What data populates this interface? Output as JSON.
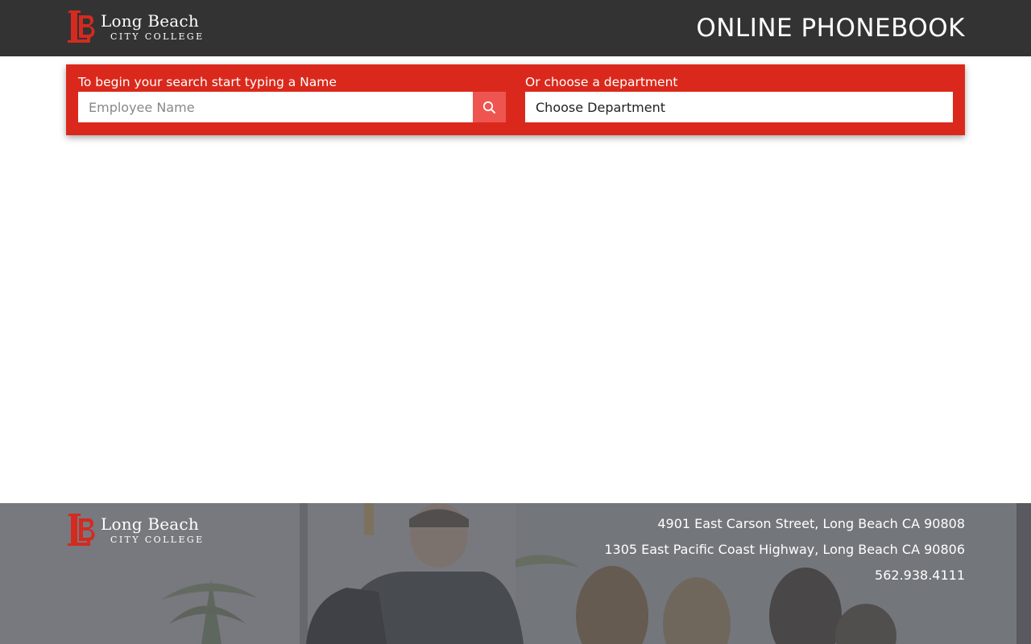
{
  "header": {
    "logo": {
      "line1": "Long Beach",
      "line2": "City College",
      "mark": "LB"
    },
    "title": "ONLINE PHONEBOOK"
  },
  "search": {
    "name_label": "To begin your search start typing a Name",
    "name_placeholder": "Employee Name",
    "search_icon": "search-icon",
    "department_label": "Or choose a department",
    "department_selected": "Choose Department"
  },
  "footer": {
    "logo": {
      "line1": "Long Beach",
      "line2": "City College",
      "mark": "LB"
    },
    "address1": "4901 East Carson Street, Long Beach CA 90808",
    "address2": "1305 East Pacific Coast Highway, Long Beach CA 90806",
    "phone": "562.938.4111"
  },
  "colors": {
    "header_bg": "#333333",
    "brand_red": "#da291c",
    "search_button": "#ee5550"
  }
}
